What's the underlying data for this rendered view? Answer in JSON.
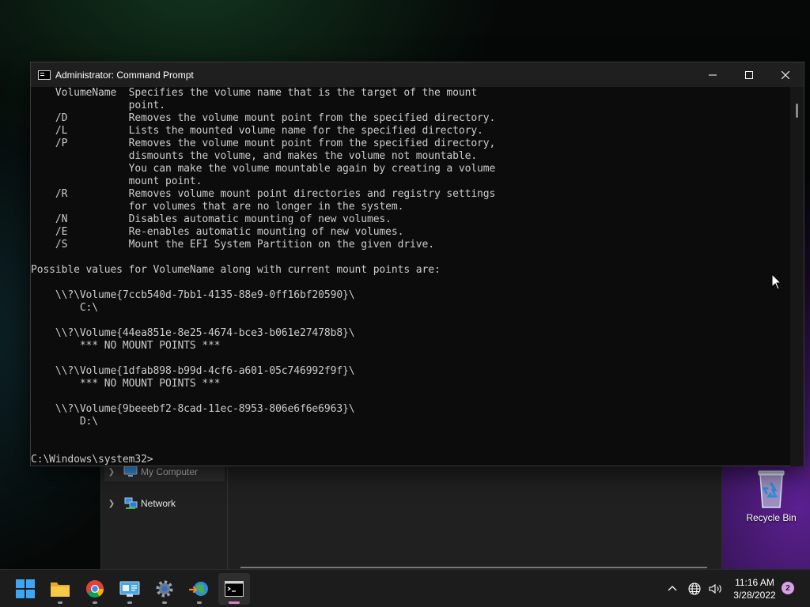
{
  "window": {
    "title": "Administrator: Command Prompt",
    "console_text": "    VolumeName  Specifies the volume name that is the target of the mount\n                point.\n    /D          Removes the volume mount point from the specified directory.\n    /L          Lists the mounted volume name for the specified directory.\n    /P          Removes the volume mount point from the specified directory,\n                dismounts the volume, and makes the volume not mountable.\n                You can make the volume mountable again by creating a volume\n                mount point.\n    /R          Removes volume mount point directories and registry settings\n                for volumes that are no longer in the system.\n    /N          Disables automatic mounting of new volumes.\n    /E          Re-enables automatic mounting of new volumes.\n    /S          Mount the EFI System Partition on the given drive.\n\nPossible values for VolumeName along with current mount points are:\n\n    \\\\?\\Volume{7ccb540d-7bb1-4135-88e9-0ff16bf20590}\\\n        C:\\\n\n    \\\\?\\Volume{44ea851e-8e25-4674-bce3-b061e27478b8}\\\n        *** NO MOUNT POINTS ***\n\n    \\\\?\\Volume{1dfab898-b99d-4cf6-a601-05c746992f9f}\\\n        *** NO MOUNT POINTS ***\n\n    \\\\?\\Volume{9beeebf2-8cad-11ec-8953-806e6f6e6963}\\\n        D:\\\n\n\nC:\\Windows\\system32>"
  },
  "explorer_nav": {
    "items": [
      {
        "label": "My Computer",
        "icon": "monitor-icon",
        "selected": true
      },
      {
        "label": "Network",
        "icon": "network-icon",
        "selected": false
      }
    ]
  },
  "desktop": {
    "recycle_bin_label": "Recycle Bin"
  },
  "taskbar": {
    "apps": [
      {
        "name": "start",
        "icon": "windows-logo-icon"
      },
      {
        "name": "file-explorer",
        "icon": "folder-icon"
      },
      {
        "name": "chrome",
        "icon": "chrome-icon"
      },
      {
        "name": "control-panel",
        "icon": "control-panel-icon"
      },
      {
        "name": "settings",
        "icon": "gear-icon"
      },
      {
        "name": "network-app",
        "icon": "globe-arrow-icon"
      },
      {
        "name": "command-prompt",
        "icon": "terminal-icon",
        "active": true
      }
    ],
    "clock_time": "11:16 AM",
    "clock_date": "3/28/2022",
    "notification_count": "2"
  },
  "colors": {
    "console_bg": "#0c0c0c",
    "console_text": "#cccccc",
    "titlebar_bg": "#1f1f1f",
    "taskbar_bg": "#1c1c1c",
    "active_indicator": "#d782c9"
  }
}
